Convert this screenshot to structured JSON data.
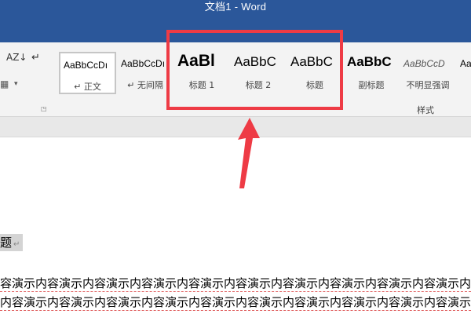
{
  "window": {
    "title": "文档1 - Word"
  },
  "ribbon": {
    "styles": [
      {
        "preview": "AaBbCcDı",
        "label": "↵ 正文"
      },
      {
        "preview": "AaBbCcDı",
        "label": "↵ 无间隔"
      },
      {
        "preview": "AaBl",
        "label": "标题 1"
      },
      {
        "preview": "AaBbC",
        "label": "标题 2"
      },
      {
        "preview": "AaBbC",
        "label": "标题"
      },
      {
        "preview": "AaBbC",
        "label": "副标题"
      },
      {
        "preview": "AaBbCcD",
        "label": "不明显强调"
      },
      {
        "preview": "Aa",
        "label": ""
      }
    ],
    "group_label": "样式",
    "icons": {
      "sort": "AZ↓",
      "para_mark": "↵",
      "border": "▦",
      "dropdown": "▾",
      "launcher": "◳"
    }
  },
  "document": {
    "heading_fragment": "题",
    "heading_mark": "↵",
    "body_lines": [
      "容演示内容演示内容演示内容演示内容演示内容演示内容演示内容演示内容演示内容演示内",
      "内容演示内容演示内容演示内容演示内容演示内容演示内容演示内容演示内容演示内容演示"
    ]
  },
  "colors": {
    "titlebar": "#2b579a",
    "annotation": "#ee3b45",
    "ribbon_bg": "#f3f3f3"
  }
}
